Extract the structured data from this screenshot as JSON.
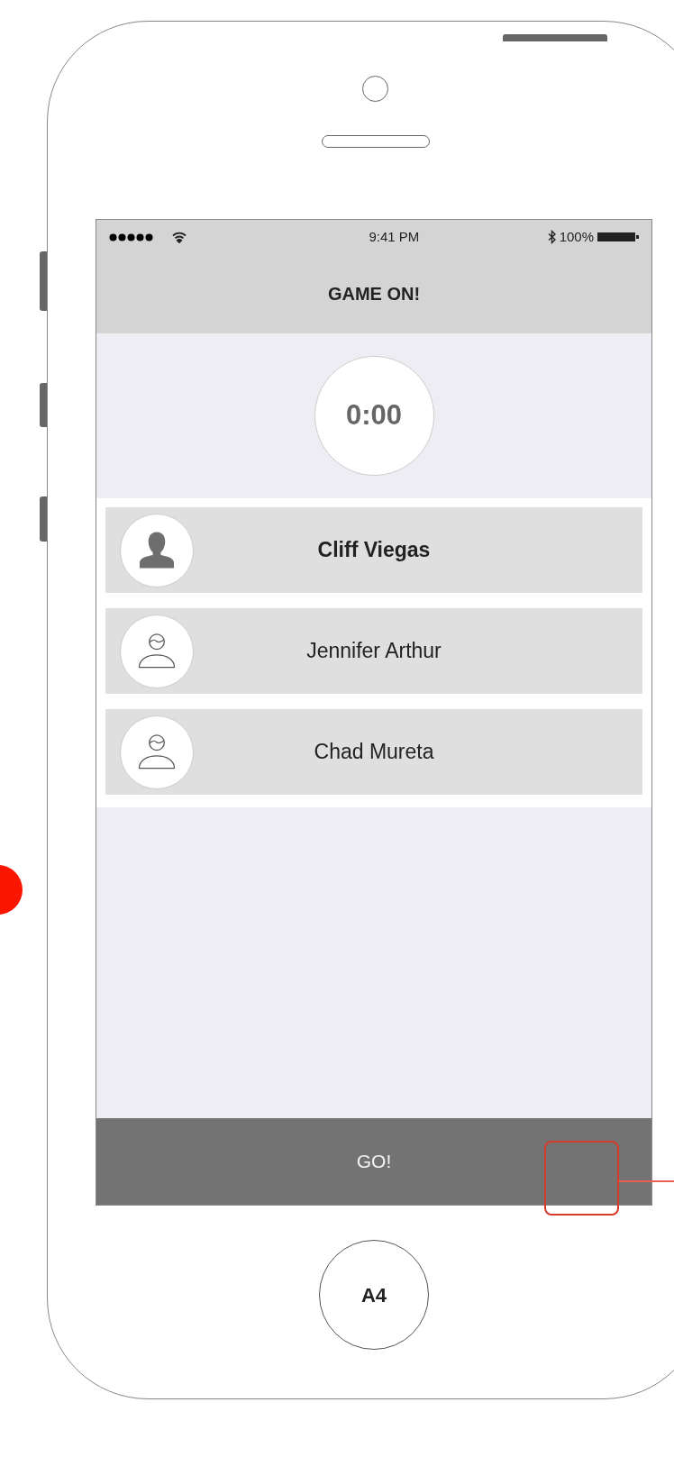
{
  "status_bar": {
    "time": "9:41 PM",
    "battery": "100%"
  },
  "title": "GAME ON!",
  "timer": "0:00",
  "players": [
    {
      "name": "Cliff Viegas",
      "selected": true
    },
    {
      "name": "Jennifer Arthur",
      "selected": false
    },
    {
      "name": "Chad Mureta",
      "selected": false
    }
  ],
  "go_button": "GO!",
  "home_button": "A4"
}
